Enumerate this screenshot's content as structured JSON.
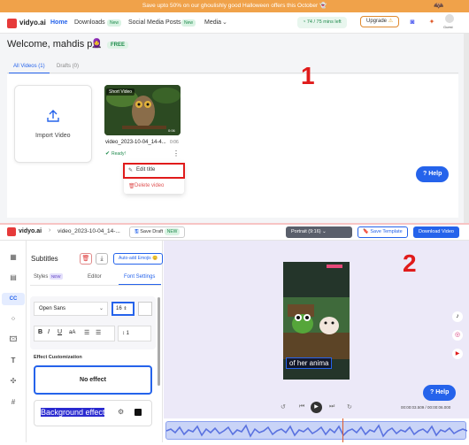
{
  "promo": {
    "text": "Save upto 50% on our ghoulishly good Halloween offers this October 👻"
  },
  "nav": {
    "brand": "vidyo.ai",
    "home": "Home",
    "downloads": "Downloads",
    "downloads_badge": "New",
    "social": "Social Media Posts",
    "social_badge": "New",
    "media": "Media",
    "minutes": "74 / 75 mins left",
    "upgrade": "Upgrade",
    "avatar_label": "Guest"
  },
  "welcome": {
    "text": "Welcome, mahdis p",
    "badge": "FREE"
  },
  "tabs": {
    "all": "All Videos (1)",
    "drafts": "Drafts (0)"
  },
  "import": {
    "label": "Import Video"
  },
  "video": {
    "badge": "Short Video",
    "duration": "0:06",
    "title": "video_2023-10-04_14-4...",
    "duration2": "0:06",
    "status": "Ready!"
  },
  "menu": {
    "edit": "Edit title",
    "delete": "Delete video"
  },
  "help": "Help",
  "annot": {
    "one": "1",
    "two": "2"
  },
  "editor": {
    "brand": "vidyo.ai",
    "file": "video_2023-10-04_14-...",
    "save_draft": "Save Draft",
    "new": "NEW",
    "aspect": "Portrait (9:16)",
    "save_template": "Save Template",
    "download": "Download Video"
  },
  "panel": {
    "title": "Subtitles",
    "auto_emoji": "Auto-add Emojis 😊",
    "tab_styles": "Styles",
    "tab_styles_badge": "NEW",
    "tab_editor": "Editor",
    "tab_font": "Font Settings",
    "font": "Open Sans",
    "size": "16",
    "spacing": "1",
    "section": "Effect Customization",
    "no_effect": "No effect",
    "bg_effect": "Background effect"
  },
  "video_caption": "of her anima",
  "time": "00:00:03.509 / 00:00:06.000",
  "help2": "Help"
}
